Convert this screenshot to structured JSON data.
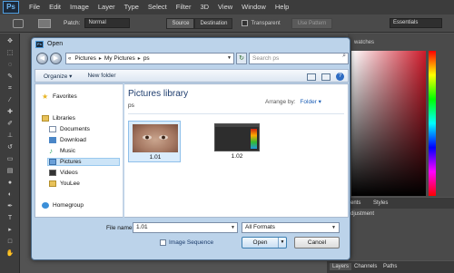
{
  "ps": {
    "logo": "Ps",
    "menu": [
      "File",
      "Edit",
      "Image",
      "Layer",
      "Type",
      "Select",
      "Filter",
      "3D",
      "View",
      "Window",
      "Help"
    ],
    "options": {
      "patch_label": "Patch:",
      "patch_mode": "Normal",
      "source": "Source",
      "destination": "Destination",
      "transparent": "Transparent",
      "use_pattern": "Use Pattern",
      "workspace": "Essentials"
    },
    "panels": {
      "swatches_tab": "watches",
      "adjustments_tab": "ents",
      "styles_tab": "Styles",
      "adjustment_title": "djustment",
      "layers_tab": "Layers",
      "channels_tab": "Channels",
      "paths_tab": "Paths"
    }
  },
  "dialog": {
    "title": "Open",
    "breadcrumbs": [
      "Pictures",
      "My Pictures",
      "ps"
    ],
    "search_placeholder": "Search ps",
    "commands": {
      "organize": "Organize ▾",
      "new_folder": "New folder"
    },
    "nav": {
      "favorites": "Favorites",
      "libraries": "Libraries",
      "documents": "Documents",
      "downloads": "Download",
      "music": "Music",
      "pictures": "Pictures",
      "videos": "Videos",
      "youlee": "YouLee",
      "homegroup": "Homegroup"
    },
    "library": {
      "title": "Pictures library",
      "subtitle": "ps",
      "arrange_label": "Arrange by:",
      "arrange_value": "Folder ▾"
    },
    "files": [
      {
        "name": "1.01"
      },
      {
        "name": "1.02"
      }
    ],
    "filename_label": "File name:",
    "filename_value": "1.01",
    "format": "All Formats",
    "image_sequence": "Image Sequence",
    "open": "Open",
    "cancel": "Cancel"
  }
}
